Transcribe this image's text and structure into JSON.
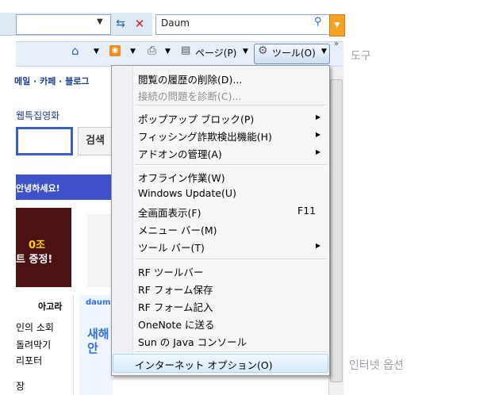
{
  "browser": {
    "search_provider": "Daum",
    "command_bar": {
      "page_label": "ページ(P)",
      "tools_label": "ツール(O)",
      "tools_tooltip_korean": "도구"
    }
  },
  "page": {
    "nav_links": "메일 · 카페 · 블로그",
    "tabs_text": "웹특집영화",
    "search_button": "검색",
    "banner_text": "안녕하세요!",
    "promo_line1": "0조",
    "promo_line2": "트 증정!",
    "entertainment_title": "아고라",
    "entertainment_items": [
      "인의 소회",
      "돌려막기",
      "리포터",
      "장"
    ],
    "ad_logo": "daum",
    "ad_text": "새해\n안"
  },
  "menu": {
    "items": [
      {
        "label": "閲覧の履歴の削除(D)...",
        "disabled": false
      },
      {
        "label": "接続の問題を診断(C)...",
        "disabled": true
      },
      {
        "label": "ポップアップ ブロック(P)",
        "submenu": true
      },
      {
        "label": "フィッシング詐欺検出機能(H)",
        "submenu": true
      },
      {
        "label": "アドオンの管理(A)",
        "submenu": true
      },
      {
        "label": "オフライン作業(W)"
      },
      {
        "label": "Windows Update(U)"
      },
      {
        "label": "全画面表示(F)",
        "shortcut": "F11"
      },
      {
        "label": "メニュー バー(M)"
      },
      {
        "label": "ツール バー(T)",
        "submenu": true
      },
      {
        "label": "RF ツールバー"
      },
      {
        "label": "RF フォーム保存"
      },
      {
        "label": "RF フォーム記入"
      },
      {
        "label": "OneNote に送る"
      },
      {
        "label": "Sun の Java コンソール"
      },
      {
        "label": "インターネット オプション(O)",
        "highlighted": true
      }
    ],
    "highlighted_tooltip_korean": "인터넷 옵션"
  }
}
